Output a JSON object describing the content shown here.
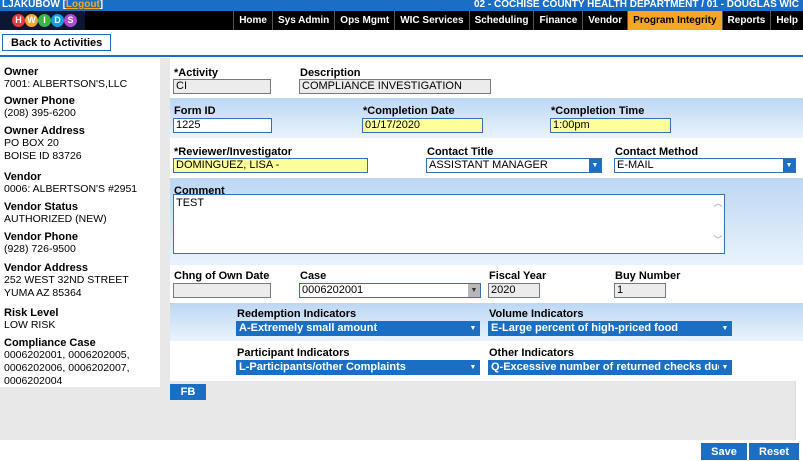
{
  "topbar": {
    "user": "LJAKUBOW",
    "user_bracket_open": "[",
    "logout": "Logout",
    "user_bracket_close": "]",
    "agency": "02 - COCHISE COUNTY HEALTH DEPARTMENT / 01 - DOUGLAS WIC"
  },
  "logo": {
    "letters": [
      "H",
      "W",
      "I",
      "D",
      "S"
    ],
    "colors": [
      "#e23b3b",
      "#f6a623",
      "#3ab54a",
      "#1a9be0",
      "#b04ad0"
    ]
  },
  "menu": [
    "Home",
    "Sys Admin",
    "Ops Mgmt",
    "WIC Services",
    "Scheduling",
    "Finance",
    "Vendor",
    "Program Integrity",
    "Reports",
    "Help"
  ],
  "menu_active": "Program Integrity",
  "back_label": "Back to Activities",
  "left": {
    "owner_label": "Owner",
    "owner": "7001: ALBERTSON'S,LLC",
    "owner_phone_label": "Owner Phone",
    "owner_phone": "(208) 395-6200",
    "owner_address_label": "Owner Address",
    "owner_address1": "PO BOX 20",
    "owner_address2": "BOISE ID 83726",
    "vendor_label": "Vendor",
    "vendor": "0006: ALBERTSON'S #2951",
    "vendor_status_label": "Vendor Status",
    "vendor_status": "AUTHORIZED (NEW)",
    "vendor_phone_label": "Vendor Phone",
    "vendor_phone": "(928) 726-9500",
    "vendor_address_label": "Vendor Address",
    "vendor_address1": "252 WEST 32ND STREET",
    "vendor_address2": "YUMA AZ 85364",
    "risk_label": "Risk Level",
    "risk": "LOW RISK",
    "compliance_label": "Compliance Case",
    "compliance1": "0006202001, 0006202005,",
    "compliance2": "0006202006, 0006202007,",
    "compliance3": "0006202004"
  },
  "form": {
    "activity_label": "*Activity",
    "activity": "CI",
    "description_label": "Description",
    "description": "COMPLIANCE INVESTIGATION",
    "formid_label": "Form ID",
    "formid": "1225",
    "completion_date_label": "*Completion Date",
    "completion_date": "01/17/2020",
    "completion_time_label": "*Completion Time",
    "completion_time": "1:00pm",
    "reviewer_label": "*Reviewer/Investigator",
    "reviewer": "DOMINGUEZ, LISA  -",
    "contact_title_label": "Contact Title",
    "contact_title": "ASSISTANT MANAGER",
    "contact_method_label": "Contact Method",
    "contact_method": "E-MAIL",
    "comment_label": "Comment",
    "comment": "TEST",
    "chng_label": "Chng of Own Date",
    "chng": "",
    "case_label": "Case",
    "case": "0006202001",
    "fiscal_label": "Fiscal Year",
    "fiscal": "2020",
    "buy_label": "Buy Number",
    "buy": "1",
    "redemption_label": "Redemption Indicators",
    "redemption": "A-Extremely small amount",
    "volume_label": "Volume Indicators",
    "volume": "E-Large percent of high-priced food",
    "participant_label": "Participant Indicators",
    "participant": "L-Participants/other Complaints",
    "other_label": "Other Indicators",
    "other": "Q-Excessive number of returned checks due"
  },
  "buttons": {
    "fb": "FB",
    "save": "Save",
    "reset": "Reset"
  },
  "icons": {
    "dropdown": "▼",
    "scroll_up": "︿",
    "scroll_down": "﹀"
  }
}
